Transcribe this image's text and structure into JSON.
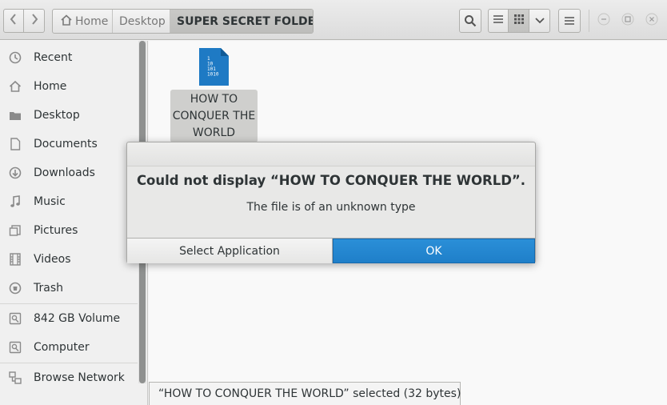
{
  "window": {
    "nav": {
      "back_icon": "chevron-left-icon",
      "forward_icon": "chevron-right-icon"
    },
    "pathbar": {
      "home": "Home",
      "desktop": "Desktop",
      "current": "SUPER SECRET FOLDER"
    },
    "toolbar": {
      "search_icon": "search-icon",
      "list_view_icon": "list-view-icon",
      "grid_view_icon": "grid-view-icon",
      "view_options_icon": "chevron-down-icon",
      "menu_icon": "hamburger-menu-icon"
    },
    "window_controls": [
      "minimize",
      "maximize",
      "close"
    ]
  },
  "sidebar": {
    "items": [
      {
        "label": "Recent",
        "icon": "clock-icon"
      },
      {
        "label": "Home",
        "icon": "home-icon"
      },
      {
        "label": "Desktop",
        "icon": "folder-icon"
      },
      {
        "label": "Documents",
        "icon": "document-icon"
      },
      {
        "label": "Downloads",
        "icon": "download-icon"
      },
      {
        "label": "Music",
        "icon": "music-icon"
      },
      {
        "label": "Pictures",
        "icon": "pictures-icon"
      },
      {
        "label": "Videos",
        "icon": "film-icon"
      },
      {
        "label": "Trash",
        "icon": "trash-icon"
      },
      {
        "label": "842 GB Volume",
        "icon": "drive-icon"
      },
      {
        "label": "Computer",
        "icon": "drive-icon"
      },
      {
        "label": "Browse Network",
        "icon": "network-icon"
      }
    ]
  },
  "content": {
    "file": {
      "name_lines": [
        "HOW TO",
        "CONQUER THE",
        "WORLD"
      ],
      "icon_text": [
        "1",
        "10",
        "101",
        "1010"
      ],
      "icon_color": "#1e7ac4"
    }
  },
  "statusbar": {
    "text": "“HOW TO CONQUER THE WORLD” selected  (32 bytes)"
  },
  "dialog": {
    "title": "Could not display “HOW TO CONQUER THE WORLD”.",
    "message": "The file is of an unknown type",
    "secondary_button": "Select Application",
    "primary_button": "OK"
  },
  "colors": {
    "accent": "#2a8fd8",
    "selection": "#cfcfcd"
  }
}
